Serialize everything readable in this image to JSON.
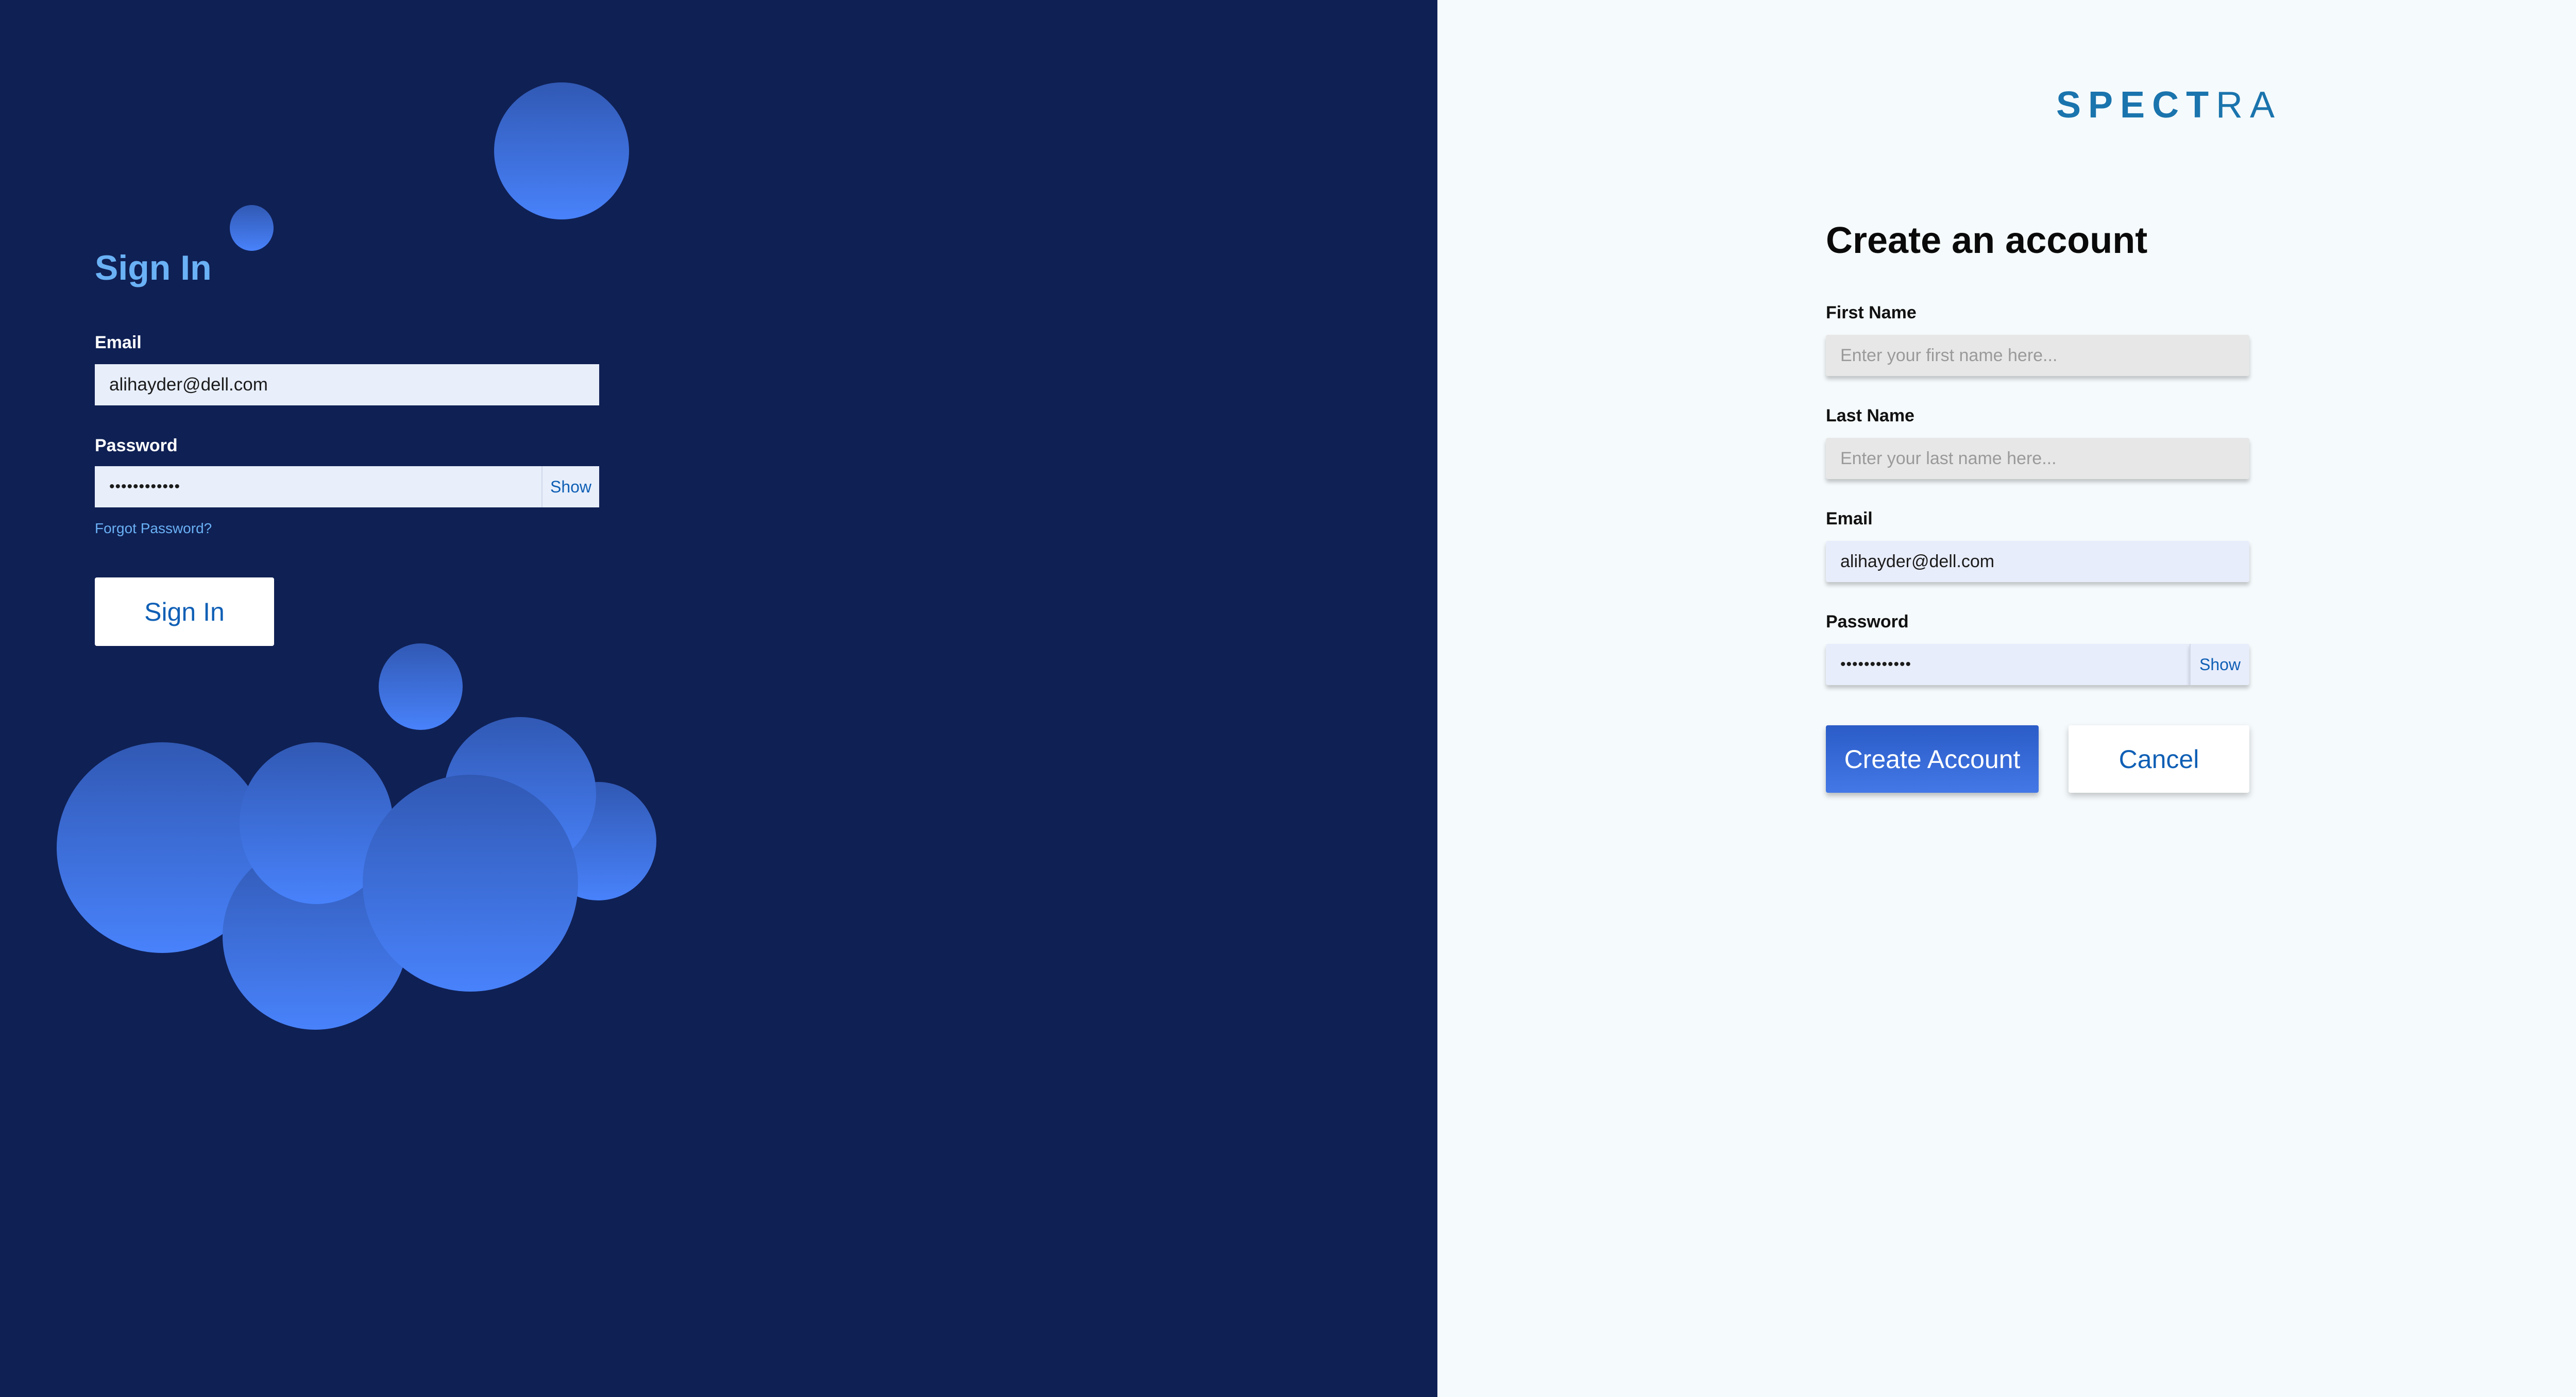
{
  "colors": {
    "left_background": "#0f2054",
    "right_background": "#f5fafc",
    "accent_blue": "#0f5fb5",
    "signin_title": "#6ab1f5",
    "bubble_gradient_top": "#3159b4",
    "bubble_gradient_bottom": "#4882fb",
    "brand": "#1a74ad"
  },
  "sign_in": {
    "title": "Sign In",
    "email_label": "Email",
    "email_value": "alihayder@dell.com",
    "password_label": "Password",
    "password_value": "••••••••••••",
    "show_label": "Show",
    "forgot_password": "Forgot Password?",
    "button_label": "Sign In"
  },
  "brand": {
    "bold_part": "SPECT",
    "light_part": "RA"
  },
  "create_account": {
    "title": "Create an account",
    "first_name_label": "First Name",
    "first_name_placeholder": "Enter your first name here...",
    "last_name_label": "Last Name",
    "last_name_placeholder": "Enter your last name here...",
    "email_label": "Email",
    "email_value": "alihayder@dell.com",
    "password_label": "Password",
    "password_value": "••••••••••••",
    "show_label": "Show",
    "create_button": "Create Account",
    "cancel_button": "Cancel"
  }
}
